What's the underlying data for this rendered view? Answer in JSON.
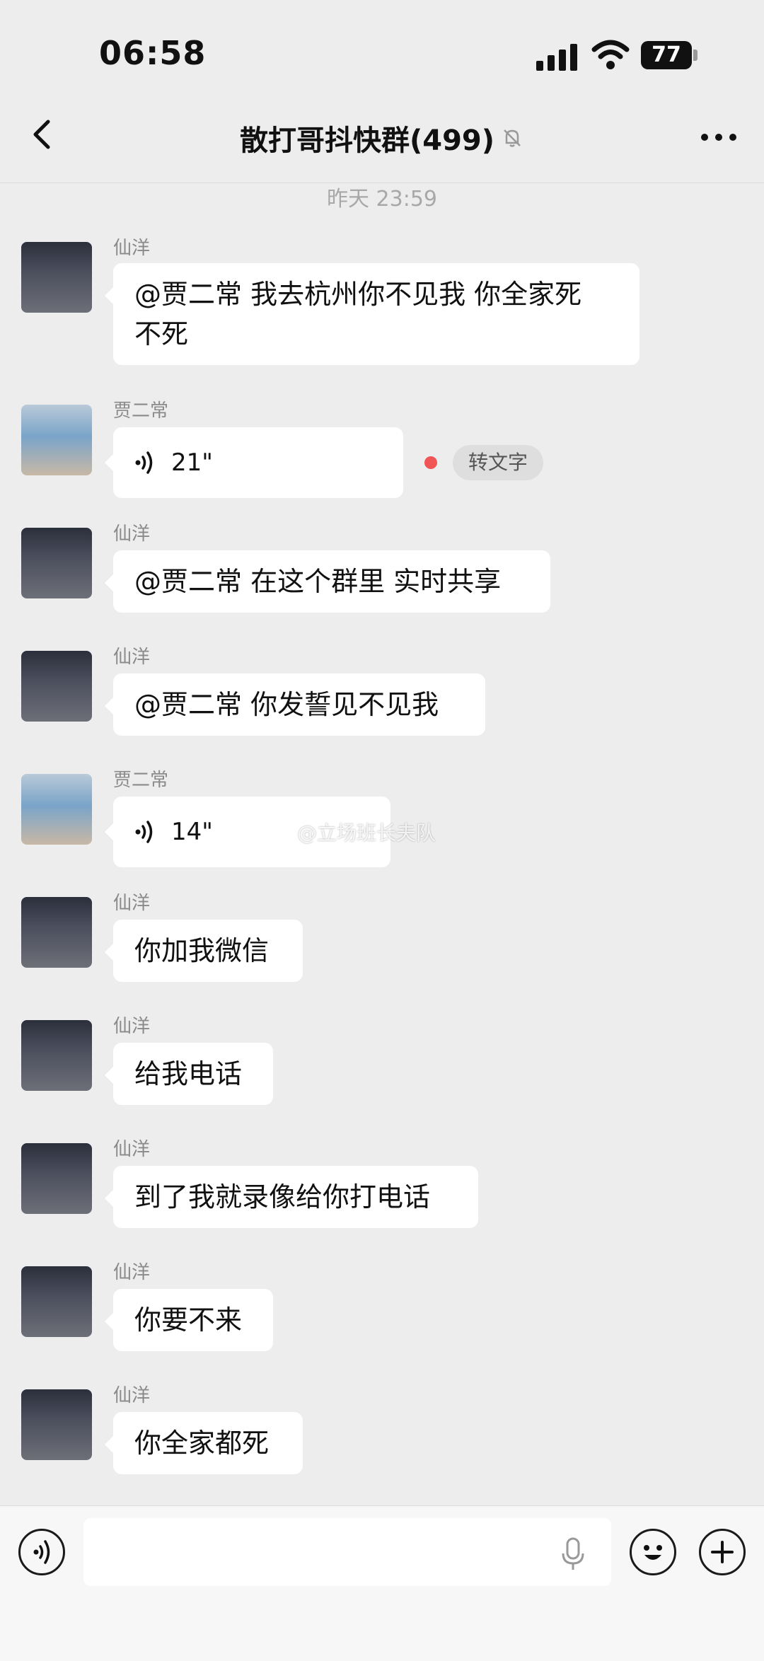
{
  "status": {
    "time": "06:58",
    "battery": "77"
  },
  "header": {
    "title": "散打哥抖快群(499)"
  },
  "timestamp": "昨天 23:59",
  "messages": [
    {
      "sender": "仙洋",
      "text": "@贾二常 我去杭州你不见我 你全家死\n不死"
    },
    {
      "sender": "贾二常",
      "duration": "21\"",
      "to_text": "转文字"
    },
    {
      "sender": "仙洋",
      "text": "@贾二常 在这个群里 实时共享"
    },
    {
      "sender": "仙洋",
      "text": "@贾二常 你发誓见不见我"
    },
    {
      "sender": "贾二常",
      "duration": "14\""
    },
    {
      "sender": "仙洋",
      "text": "你加我微信"
    },
    {
      "sender": "仙洋",
      "text": "给我电话"
    },
    {
      "sender": "仙洋",
      "text": "到了我就录像给你打电话"
    },
    {
      "sender": "仙洋",
      "text": "你要不来"
    },
    {
      "sender": "仙洋",
      "text": "你全家都死"
    }
  ],
  "watermark": "@立场班长夫队",
  "icons": {
    "back": "chevron-left-icon",
    "mute": "bell-off-icon",
    "more": "more-icon",
    "voice_toggle": "voice-toggle-icon",
    "mic": "mic-icon",
    "emoji": "emoji-icon",
    "add": "plus-icon"
  },
  "colors": {
    "background": "#ededed",
    "bubble": "#ffffff",
    "unread_dot": "#f05454"
  }
}
